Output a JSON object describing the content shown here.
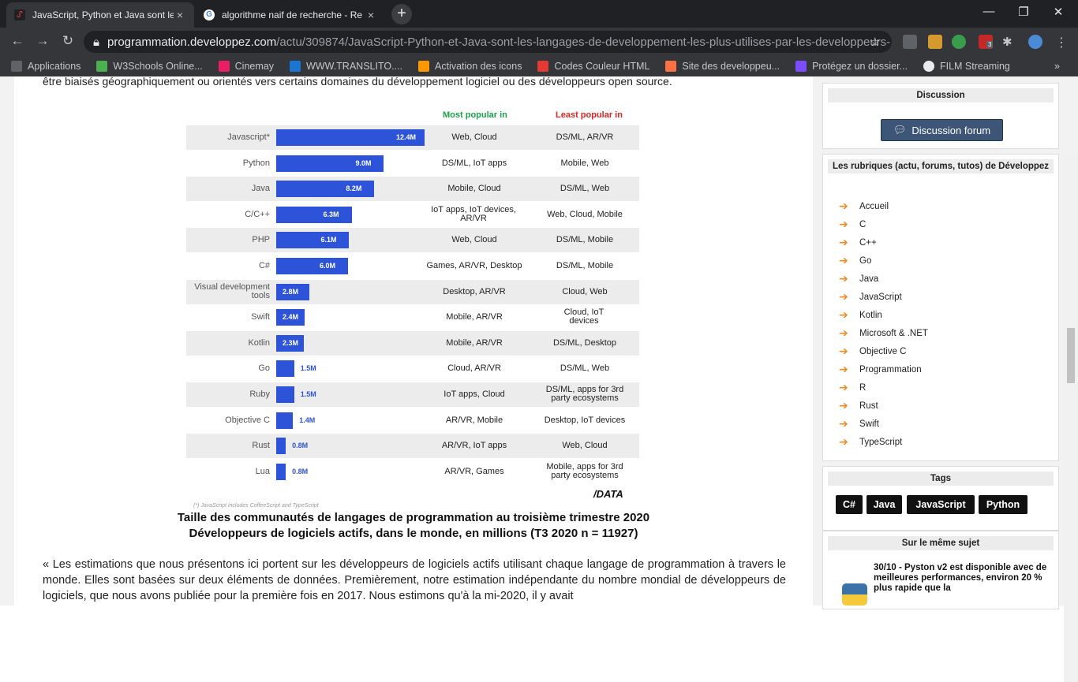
{
  "browser": {
    "tabs": [
      {
        "title": "JavaScript, Python et Java sont le",
        "close": "×"
      },
      {
        "title": "algorithme naif de recherche - Re",
        "close": "×"
      }
    ],
    "new_tab": "+",
    "window": {
      "minimize": "—",
      "restore": "❐",
      "close": "✕"
    },
    "nav": {
      "back": "←",
      "forward": "→",
      "reload": "↻"
    },
    "url": {
      "host": "programmation.developpez.com",
      "path": "/actu/309874/JavaScript-Python-et-Java-sont-les-langages-de-developpement-les-plus-utilises-par-les-developpeurs-..."
    },
    "ext_badge": "3",
    "bookmarks": [
      {
        "label": "Applications",
        "color": "#5f6368"
      },
      {
        "label": "W3Schools Online...",
        "color": "#4caf50"
      },
      {
        "label": "Cinemay",
        "color": "#e91e63"
      },
      {
        "label": "WWW.TRANSLITO....",
        "color": "#1976d2"
      },
      {
        "label": "Activation des icons",
        "color": "#ff9800"
      },
      {
        "label": "Codes Couleur HTML",
        "color": "#e53935"
      },
      {
        "label": "Site des developpeu...",
        "color": "#ff7043"
      },
      {
        "label": "Protégez un dossier...",
        "color": "#7c4dff"
      },
      {
        "label": "FILM Streaming",
        "color": "#e8eaed"
      }
    ]
  },
  "article": {
    "intro": "être biaisés géographiquement ou orientés vers certains domaines du développement logiciel ou des développeurs open source.",
    "caption_line1": "Taille des communautés de langages de programmation au troisième trimestre 2020",
    "caption_line2": "Développeurs de logiciels actifs, dans le monde, en millions (T3 2020 n = 11927)",
    "body": "« Les estimations que nous présentons ici portent sur les développeurs de logiciels actifs utilisant chaque langage de programmation à travers le monde. Elles sont basées sur deux éléments de données. Premièrement, notre estimation indépendante du nombre mondial de développeurs de logiciels, que nous avons publiée pour la première fois en 2017. Nous estimons qu'à la mi-2020, il y avait"
  },
  "chart_data": {
    "type": "bar",
    "orientation": "horizontal",
    "header_popular": "Most popular in",
    "header_least": "Least popular in",
    "footnote": "(*) JavaScript includes CoffeeScript and TypeScript",
    "logo": "/DATA",
    "categories": [
      "Javascript*",
      "Python",
      "Java",
      "C/C++",
      "PHP",
      "C#",
      "Visual development tools",
      "Swift",
      "Kotlin",
      "Go",
      "Ruby",
      "Objective C",
      "Rust",
      "Lua"
    ],
    "values": [
      12.4,
      9.0,
      8.2,
      6.3,
      6.1,
      6.0,
      2.8,
      2.4,
      2.3,
      1.5,
      1.5,
      1.4,
      0.8,
      0.8
    ],
    "value_labels": [
      "12.4M",
      "9.0M",
      "8.2M",
      "6.3M",
      "6.1M",
      "6.0M",
      "2.8M",
      "2.4M",
      "2.3M",
      "1.5M",
      "1.5M",
      "1.4M",
      "0.8M",
      "0.8M"
    ],
    "most_popular": [
      "Web, Cloud",
      "DS/ML, IoT apps",
      "Mobile, Cloud",
      "IoT apps, IoT devices, AR/VR",
      "Web, Cloud",
      "Games, AR/VR, Desktop",
      "Desktop, AR/VR",
      "Mobile, AR/VR",
      "Mobile, AR/VR",
      "Cloud, AR/VR",
      "IoT apps, Cloud",
      "AR/VR, Mobile",
      "AR/VR, IoT apps",
      "AR/VR, Games"
    ],
    "least_popular": [
      "DS/ML, AR/VR",
      "Mobile, Web",
      "DS/ML, Web",
      "Web, Cloud, Mobile",
      "DS/ML, Mobile",
      "DS/ML, Mobile",
      "Cloud, Web",
      "Cloud, IoT devices",
      "DS/ML, Desktop",
      "DS/ML, Web",
      "DS/ML, apps for 3rd party ecosystems",
      "Desktop, IoT devices",
      "Web, Cloud",
      "Mobile, apps for 3rd party ecosystems"
    ],
    "xlim": [
      0,
      12.4
    ],
    "bar_color": "#2d54d8",
    "popular_color": "#1aa34a",
    "least_color": "#e02424"
  },
  "sidebar": {
    "discussion_title": "Discussion",
    "forum_button": "Discussion forum",
    "rubriques_title": "Les rubriques (actu, forums, tutos) de Développez",
    "rubriques": [
      "Accueil",
      "C",
      "C++",
      "Go",
      "Java",
      "JavaScript",
      "Kotlin",
      "Microsoft & .NET",
      "Objective C",
      "Programmation",
      "R",
      "Rust",
      "Swift",
      "TypeScript"
    ],
    "tags_title": "Tags",
    "tags": [
      "C#",
      "Java",
      "JavaScript",
      "Python"
    ],
    "same_subject_title": "Sur le même sujet",
    "same_subject_item": "30/10 - Pyston v2 est disponible avec de meilleures performances, environ 20 % plus rapide que la"
  }
}
